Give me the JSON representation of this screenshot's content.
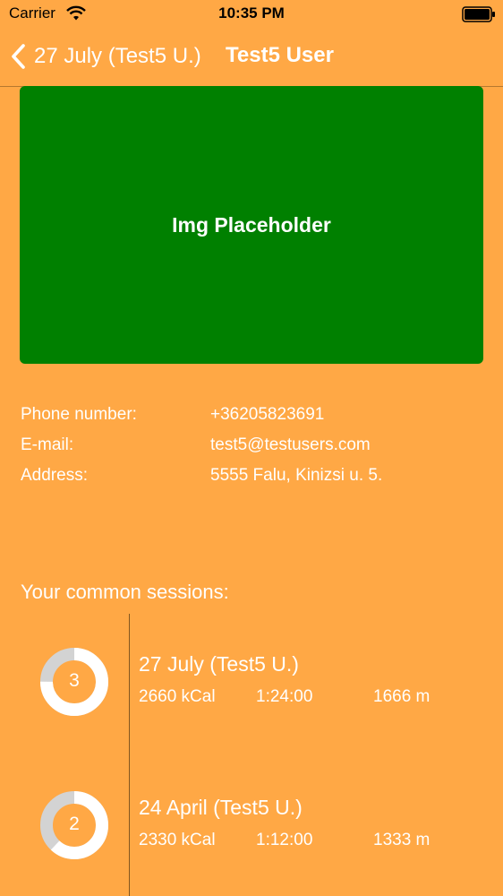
{
  "status_bar": {
    "carrier": "Carrier",
    "time": "10:35 PM",
    "wifi_icon": "wifi-icon",
    "battery_icon": "battery-icon"
  },
  "nav": {
    "back_label": "27 July (Test5 U.)",
    "title": "Test5 User",
    "back_icon": "chevron-left-icon"
  },
  "image": {
    "label": "Img Placeholder",
    "color": "#008000"
  },
  "info": [
    {
      "label": "Phone number:",
      "value": "+36205823691"
    },
    {
      "label": "E-mail:",
      "value": "test5@testusers.com"
    },
    {
      "label": "Address:",
      "value": "5555 Falu, Kinizsi u. 5."
    }
  ],
  "sessions_title": "Your common sessions:",
  "sessions": [
    {
      "number": "3",
      "title": "27 July (Test5 U.)",
      "kcal": "2660 kCal",
      "duration": "1:24:00",
      "distance": "1666 m",
      "progress": 0.75
    },
    {
      "number": "2",
      "title": "24 April (Test5 U.)",
      "kcal": "2330 kCal",
      "duration": "1:12:00",
      "distance": "1333 m",
      "progress": 0.62
    }
  ],
  "colors": {
    "background": "#FFA845",
    "ring_fill": "#FFFFFF",
    "ring_track": "#D3D3D3"
  }
}
